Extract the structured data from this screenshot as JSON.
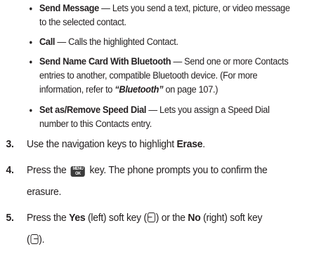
{
  "bullets": [
    {
      "term": "Send Message",
      "text": " — Lets you send a text, picture, or video message",
      "cont": "to the selected contact."
    },
    {
      "term": "Call",
      "text": " — Calls the highlighted Contact."
    },
    {
      "term": "Send Name Card With Bluetooth",
      "text": " — Send one or more Contacts",
      "cont": "entries to another, compatible Bluetooth device. (For more",
      "cont2_pre": "information, refer to ",
      "ref": "“Bluetooth”",
      "cont2_post": " on page 107.)"
    },
    {
      "term": "Set as/Remove Speed Dial",
      "text": " — Lets you assign a Speed Dial",
      "cont": "number to this Contacts entry."
    }
  ],
  "steps": [
    {
      "num": "3.",
      "pre": "Use the navigation keys to highlight ",
      "bold": "Erase",
      "post": "."
    },
    {
      "num": "4.",
      "pre": "Press the ",
      "key_top": "MENU",
      "key_bottom": "OK",
      "post": " key. The phone prompts you to confirm the",
      "cont": "erasure."
    },
    {
      "num": "5.",
      "pre": "Press the ",
      "yes": "Yes",
      "mid1": " (left) soft key (",
      "mid2": ") or the ",
      "no": "No",
      "mid3": " (right) soft key",
      "cont_pre": "(",
      "cont_post": ")."
    }
  ],
  "icons": {
    "bullet": "•",
    "menu_key": "menu-ok-key-icon",
    "left_soft_key": "left-soft-key-icon",
    "right_soft_key": "right-soft-key-icon"
  }
}
